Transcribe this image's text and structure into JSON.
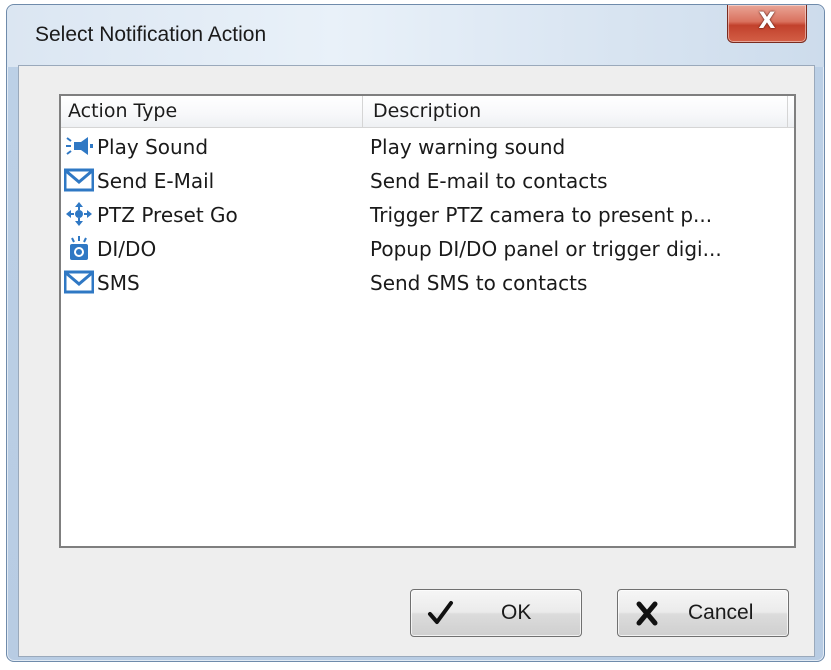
{
  "window": {
    "title": "Select Notification Action",
    "close_glyph": "X"
  },
  "list": {
    "columns": [
      "Action Type",
      "Description"
    ],
    "items": [
      {
        "icon": "speaker-icon",
        "label": "Play Sound",
        "description": "Play warning sound"
      },
      {
        "icon": "envelope-icon",
        "label": "Send E-Mail",
        "description": "Send E-mail to contacts"
      },
      {
        "icon": "ptz-arrows-icon",
        "label": "PTZ Preset Go",
        "description": "Trigger PTZ camera to present p..."
      },
      {
        "icon": "di-do-icon",
        "label": "DI/DO",
        "description": "Popup DI/DO panel or trigger digi..."
      },
      {
        "icon": "envelope-icon",
        "label": "SMS",
        "description": "Send SMS to contacts"
      }
    ]
  },
  "buttons": {
    "ok_label": "OK",
    "cancel_label": "Cancel"
  },
  "colors": {
    "icon_blue": "#2f78c4",
    "close_red": "#c2412c"
  }
}
